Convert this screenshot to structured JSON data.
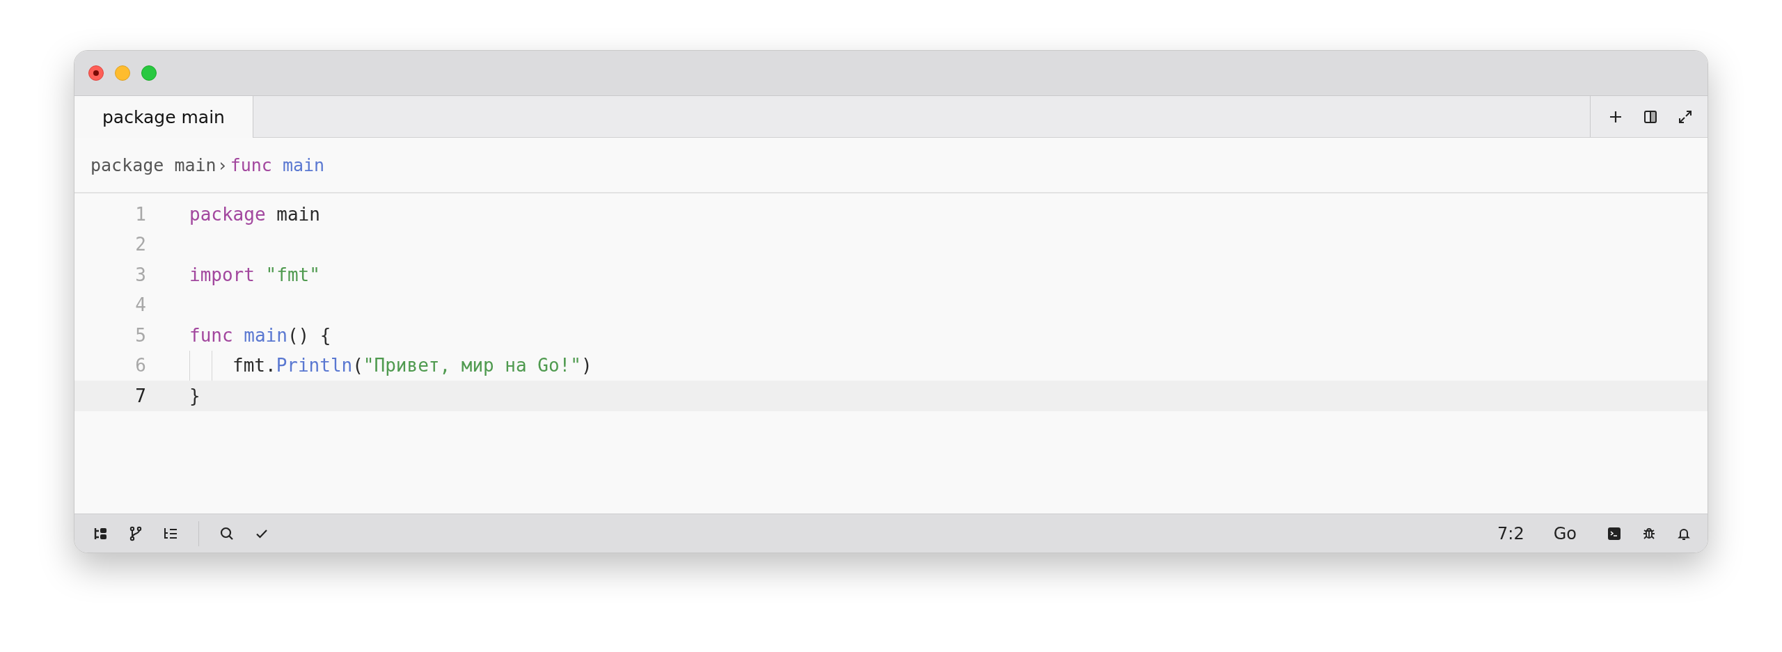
{
  "tabs": [
    {
      "label": "package main",
      "selected": true
    }
  ],
  "breadcrumb": {
    "separator": "›",
    "items": [
      {
        "tokens": [
          {
            "kind": "plain",
            "text": "package main"
          }
        ]
      },
      {
        "tokens": [
          {
            "kind": "keyword",
            "text": "func"
          },
          {
            "kind": "function",
            "text": " main"
          }
        ]
      }
    ]
  },
  "code": {
    "lines": [
      {
        "number": "1",
        "current": false,
        "indented": false,
        "tokens": [
          {
            "kind": "keyword",
            "text": "package"
          },
          {
            "kind": "plain",
            "text": " main"
          }
        ]
      },
      {
        "number": "2",
        "current": false,
        "indented": false
      },
      {
        "number": "3",
        "current": false,
        "indented": false,
        "tokens": [
          {
            "kind": "keyword",
            "text": "import"
          },
          {
            "kind": "string",
            "text": " \"fmt\""
          }
        ]
      },
      {
        "number": "4",
        "current": false,
        "indented": false
      },
      {
        "number": "5",
        "current": false,
        "indented": false,
        "tokens": [
          {
            "kind": "keyword",
            "text": "func"
          },
          {
            "kind": "function",
            "text": " main"
          },
          {
            "kind": "plain",
            "text": "() {"
          }
        ]
      },
      {
        "number": "6",
        "current": false,
        "indented": true,
        "tokens": [
          {
            "kind": "plain",
            "text": "fmt."
          },
          {
            "kind": "function",
            "text": "Println"
          },
          {
            "kind": "plain",
            "text": "("
          },
          {
            "kind": "string",
            "text": "\"Привет, мир на Go!\""
          },
          {
            "kind": "plain",
            "text": ")"
          }
        ]
      },
      {
        "number": "7",
        "current": true,
        "indented": false,
        "tokens": [
          {
            "kind": "plain",
            "text": "}"
          }
        ]
      }
    ]
  },
  "status_bar": {
    "cursor": "7:2",
    "language": "Go"
  }
}
